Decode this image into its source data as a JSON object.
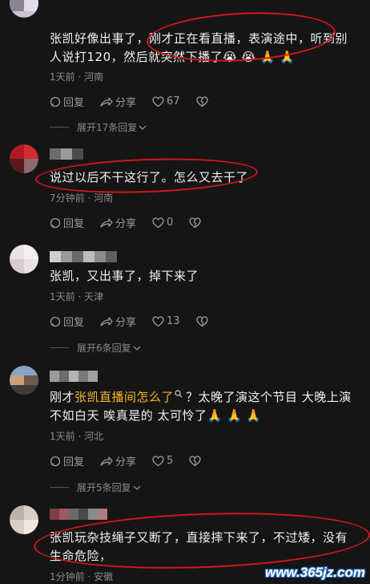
{
  "comments": [
    {
      "text": "张凯好像出事了，刚才正在看直播，表演途中，听到别人说打120，然后就突然下播了😭 😭 🙏 🙏",
      "meta": "1天前 · 河南",
      "reply_label": "回复",
      "share_label": "分享",
      "like_count": "67",
      "expand_label": "展开17条回复"
    },
    {
      "text": "说过以后不干这行了。怎么又去干了",
      "meta": "7分钟前 · 河南",
      "reply_label": "回复",
      "share_label": "分享",
      "like_count": "0"
    },
    {
      "text": "张凯，又出事了，掉下来了",
      "meta": "1天前 · 天津",
      "reply_label": "回复",
      "share_label": "分享",
      "like_count": "13",
      "expand_label": "展开6条回复"
    },
    {
      "text_before": "刚才",
      "text_highlight": "张凯直播间怎么了",
      "text_after": "？太晚了演这个节目 大晚上演不如白天 唉真是的 太可怜了🙏 🙏 🙏",
      "meta": "1天前 · 河北",
      "reply_label": "回复",
      "share_label": "分享",
      "like_count": "5",
      "expand_label": "展开5条回复"
    },
    {
      "text": "张凯玩杂技绳子又断了，直接摔下来了，不过矮，没有生命危险，",
      "meta": "1分钟前 · 安徽"
    }
  ],
  "watermark": "www.365jz.com",
  "colors": {
    "background": "#151515",
    "highlight": "#f5b52a",
    "annotation": "#d6161b"
  }
}
